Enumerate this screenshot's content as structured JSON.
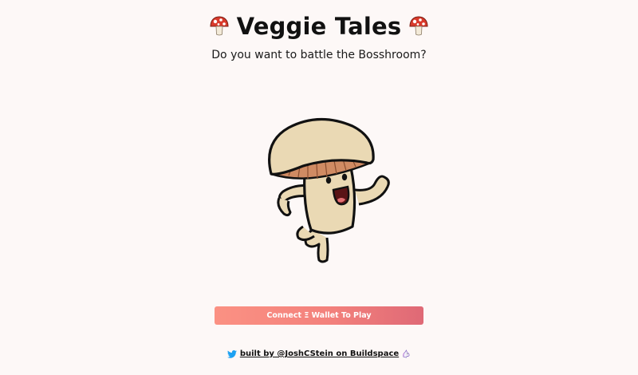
{
  "header": {
    "title": "Veggie Tales",
    "subtitle": "Do you want to battle the Bosshroom?",
    "title_icon": "mushroom-icon"
  },
  "hero": {
    "image": "dancing-mushroom-character"
  },
  "connect_button": {
    "label": "Connect Ξ Wallet To Play"
  },
  "footer": {
    "link_text": "built by @JoshCStein on Buildspace",
    "icons": [
      "twitter-icon",
      "unicorn-icon"
    ]
  },
  "colors": {
    "background": "#fdf8f7",
    "button_gradient_start": "#fb9183",
    "button_gradient_end": "#df6976",
    "twitter": "#1da1f2"
  }
}
